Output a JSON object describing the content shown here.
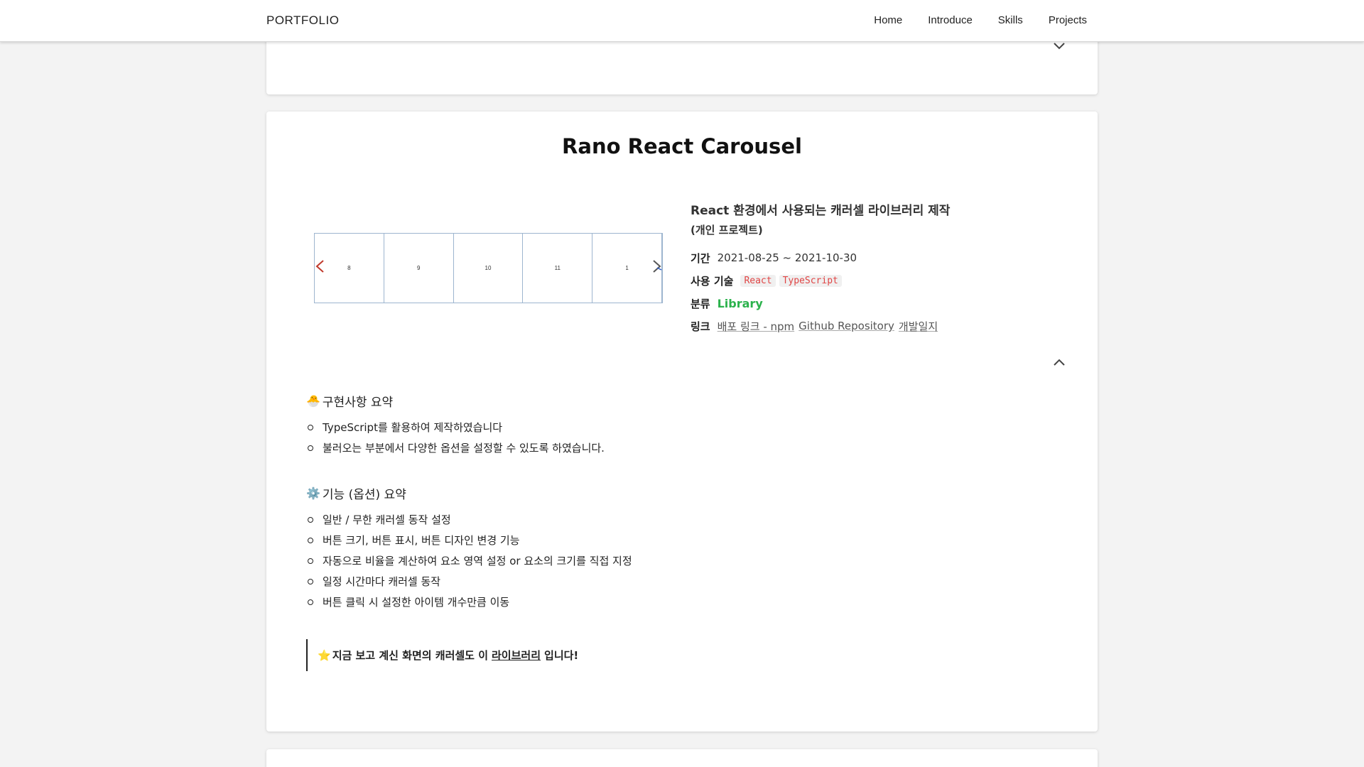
{
  "nav": {
    "brand": "PORTFOLIO",
    "links": [
      "Home",
      "Introduce",
      "Skills",
      "Projects"
    ]
  },
  "project": {
    "title": "Rano React Carousel",
    "carousel_slides": [
      "8",
      "9",
      "10",
      "11",
      "1"
    ],
    "heading": "React 환경에서 사용되는 캐러셀 라이브러리 제작",
    "subheading": "(개인 프로젝트)",
    "period_label": "기간",
    "period_value": "2021-08-25 ~ 2021-10-30",
    "tech_label": "사용 기술",
    "tech_tags": [
      "React",
      "TypeScript"
    ],
    "category_label": "분류",
    "category_value": "Library",
    "links_label": "링크",
    "links": [
      "배포 링크 - npm",
      "Github Repository",
      "개발일지"
    ]
  },
  "summary": {
    "emoji": "🐣",
    "title": "구현사항 요약",
    "items": [
      "TypeScript를 활용하여 제작하였습니다",
      "불러오는 부분에서 다양한 옵션을 설정할 수 있도록 하였습니다."
    ]
  },
  "features": {
    "emoji": "⚙️",
    "title": "기능 (옵션) 요약",
    "items": [
      "일반 / 무한 캐러셀 동작 설정",
      "버튼 크기, 버튼 표시, 버튼 디자인 변경 기능",
      "자동으로 비율을 계산하여 요소 영역 설정 or 요소의 크기를 직접 지정",
      "일정 시간마다 캐러셀 동작",
      "버튼 클릭 시 설정한 아이템 개수만큼 이동"
    ]
  },
  "callout": {
    "star": "⭐",
    "before": "지금 보고 계신 화면의 캐러셀도 이",
    "link": "라이브러리",
    "after": "입니다!"
  },
  "icons": {
    "collapse": "chevron-up-icon",
    "expand": "chevron-down-icon",
    "carousel_prev": "chevron-left-icon",
    "carousel_next": "chevron-right-icon"
  },
  "colors": {
    "category": "#2bb24c",
    "code_tag": "#e04545",
    "carousel_border": "#9db5cf"
  }
}
